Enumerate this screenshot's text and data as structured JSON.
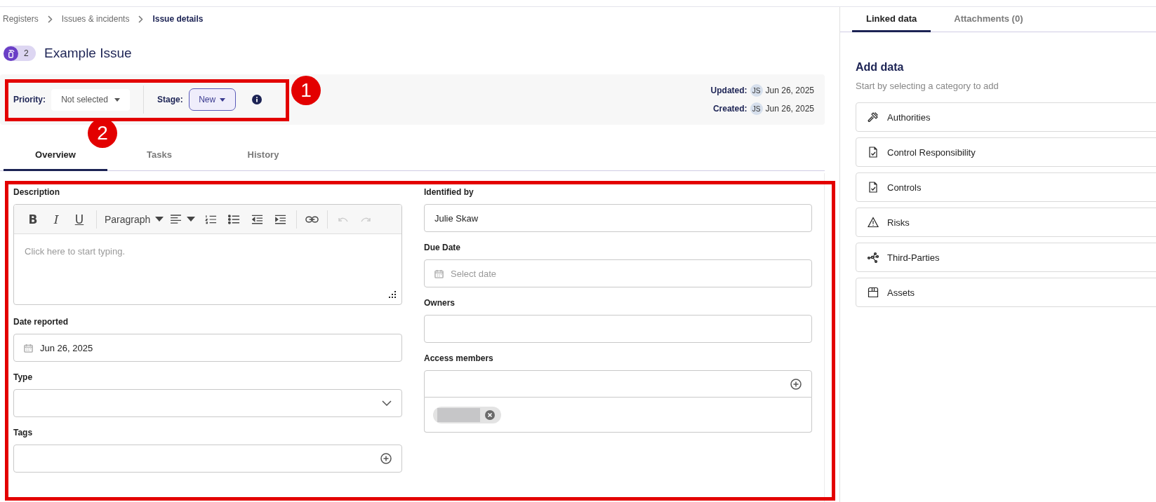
{
  "breadcrumb": [
    {
      "label": "Registers",
      "current": false
    },
    {
      "label": "Issues & incidents",
      "current": false
    },
    {
      "label": "Issue details",
      "current": true
    }
  ],
  "issue": {
    "count": "2",
    "title": "Example Issue"
  },
  "status_bar": {
    "priority_label": "Priority:",
    "priority_value": "Not selected",
    "stage_label": "Stage:",
    "stage_value": "New",
    "updated_label": "Updated:",
    "updated_initials": "JS",
    "updated_date": "Jun 26, 2025",
    "created_label": "Created:",
    "created_initials": "JS",
    "created_date": "Jun 26, 2025"
  },
  "tabs": [
    {
      "label": "Overview",
      "selected": true
    },
    {
      "label": "Tasks",
      "selected": false
    },
    {
      "label": "History",
      "selected": false
    }
  ],
  "editor": {
    "label": "Description",
    "format_buttons": [
      {
        "kind": "bold",
        "label": "B"
      },
      {
        "kind": "italic",
        "label": "I"
      },
      {
        "kind": "underline",
        "label": "U"
      }
    ],
    "block_format": "Paragraph",
    "placeholder": "Click here to start typing.",
    "undo_disabled": true,
    "redo_disabled": true
  },
  "fields_left": [
    {
      "kind": "date",
      "label": "Date reported",
      "value": "Jun 26, 2025"
    },
    {
      "kind": "select",
      "label": "Type"
    },
    {
      "kind": "tags",
      "label": "Tags"
    }
  ],
  "fields_right": [
    {
      "kind": "text",
      "label": "Identified by",
      "value": "Julie Skaw"
    },
    {
      "kind": "date",
      "label": "Due Date",
      "placeholder": "Select date"
    },
    {
      "kind": "text",
      "label": "Owners"
    },
    {
      "kind": "members",
      "label": "Access members"
    }
  ],
  "side_tabs": [
    {
      "label": "Linked data",
      "selected": true
    },
    {
      "label": "Attachments (0)",
      "selected": false
    }
  ],
  "add_data": {
    "title": "Add data",
    "subtitle": "Start by selecting a category to add",
    "categories": [
      {
        "kind": "gavel",
        "label": "Authorities"
      },
      {
        "kind": "document",
        "label": "Control Responsibility"
      },
      {
        "kind": "document",
        "label": "Controls"
      },
      {
        "kind": "warning",
        "label": "Risks"
      },
      {
        "kind": "network",
        "label": "Third-Parties"
      },
      {
        "kind": "box",
        "label": "Assets"
      }
    ]
  },
  "annotations": [
    {
      "label": "1"
    },
    {
      "label": "2"
    }
  ]
}
